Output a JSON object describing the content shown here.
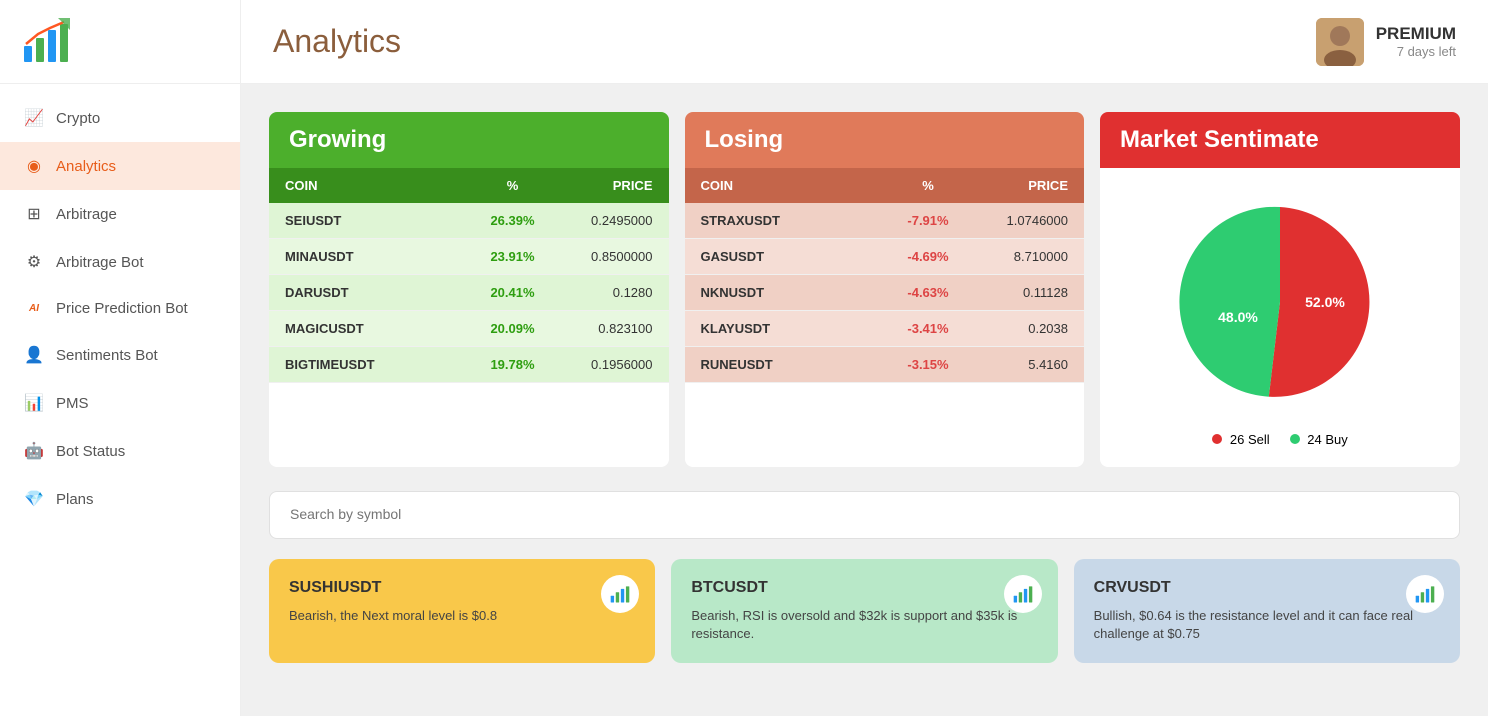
{
  "sidebar": {
    "logo_alt": "Crypto Analytics Logo",
    "items": [
      {
        "id": "crypto",
        "label": "Crypto",
        "icon": "📈",
        "active": false
      },
      {
        "id": "analytics",
        "label": "Analytics",
        "icon": "🔶",
        "active": true
      },
      {
        "id": "arbitrage",
        "label": "Arbitrage",
        "icon": "⊞",
        "active": false
      },
      {
        "id": "arbitrage-bot",
        "label": "Arbitrage Bot",
        "icon": "⚙",
        "active": false
      },
      {
        "id": "price-prediction-bot",
        "label": "Price Prediction Bot",
        "icon": "AI",
        "active": false
      },
      {
        "id": "sentiments-bot",
        "label": "Sentiments Bot",
        "icon": "👤",
        "active": false
      },
      {
        "id": "pms",
        "label": "PMS",
        "icon": "📊",
        "active": false
      },
      {
        "id": "bot-status",
        "label": "Bot Status",
        "icon": "🤖",
        "active": false
      },
      {
        "id": "plans",
        "label": "Plans",
        "icon": "💎",
        "active": false
      }
    ]
  },
  "header": {
    "title": "Analytics",
    "user": {
      "plan": "PREMIUM",
      "days_left": "7 days left"
    }
  },
  "growing": {
    "title": "Growing",
    "columns": [
      "COIN",
      "%",
      "PRICE"
    ],
    "rows": [
      {
        "coin": "SEIUSDT",
        "pct": "26.39%",
        "price": "0.2495000"
      },
      {
        "coin": "MINAUSDT",
        "pct": "23.91%",
        "price": "0.8500000"
      },
      {
        "coin": "DARUSDT",
        "pct": "20.41%",
        "price": "0.1280"
      },
      {
        "coin": "MAGICUSDT",
        "pct": "20.09%",
        "price": "0.823100"
      },
      {
        "coin": "BIGTIMEUSDT",
        "pct": "19.78%",
        "price": "0.1956000"
      }
    ]
  },
  "losing": {
    "title": "Losing",
    "columns": [
      "COIN",
      "%",
      "PRICE"
    ],
    "rows": [
      {
        "coin": "STRAXUSDT",
        "pct": "-7.91%",
        "price": "1.0746000"
      },
      {
        "coin": "GASUSDT",
        "pct": "-4.69%",
        "price": "8.710000"
      },
      {
        "coin": "NKNUSDT",
        "pct": "-4.63%",
        "price": "0.11128"
      },
      {
        "coin": "KLAYUSDT",
        "pct": "-3.41%",
        "price": "0.2038"
      },
      {
        "coin": "RUNEUSDT",
        "pct": "-3.15%",
        "price": "5.4160"
      }
    ]
  },
  "market_sentiment": {
    "title": "Market Sentimate",
    "sell_pct": 52.0,
    "buy_pct": 48.0,
    "sell_count": 26,
    "buy_count": 24,
    "sell_label": "26 Sell",
    "buy_label": "24 Buy"
  },
  "search": {
    "placeholder": "Search by symbol"
  },
  "bottom_cards": [
    {
      "symbol": "SUSHIUSDT",
      "description": "Bearish, the Next moral level is $0.8",
      "color": "card-orange"
    },
    {
      "symbol": "BTCUSDT",
      "description": "Bearish, RSI is oversold and $32k is support and $35k is resistance.",
      "color": "card-green-light"
    },
    {
      "symbol": "CRVUSDT",
      "description": "Bullish, $0.64 is the resistance level and it can face real challenge at $0.75",
      "color": "card-blue-light"
    }
  ]
}
